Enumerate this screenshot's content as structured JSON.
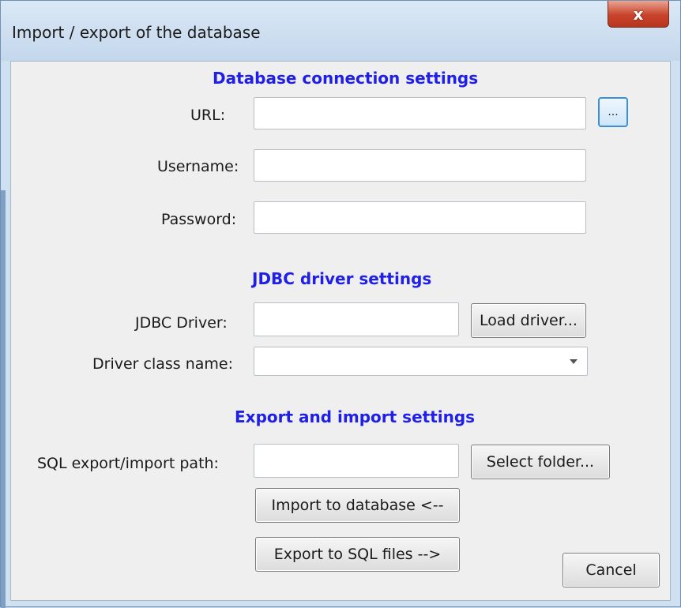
{
  "window": {
    "title": "Import / export of the database",
    "close_label": "x"
  },
  "db_section": {
    "heading": "Database connection settings",
    "url_label": "URL:",
    "url_value": "",
    "browse_label": "...",
    "username_label": "Username:",
    "username_value": "",
    "password_label": "Password:",
    "password_value": ""
  },
  "jdbc_section": {
    "heading": "JDBC driver settings",
    "driver_label": "JDBC Driver:",
    "driver_value": "",
    "load_driver_label": "Load driver...",
    "class_label": "Driver class name:",
    "class_value": ""
  },
  "export_section": {
    "heading": "Export and import settings",
    "path_label": "SQL export/import path:",
    "path_value": "",
    "select_folder_label": "Select folder...",
    "import_label": "Import to database <--",
    "export_label": "Export to SQL files -->"
  },
  "cancel_label": "Cancel"
}
